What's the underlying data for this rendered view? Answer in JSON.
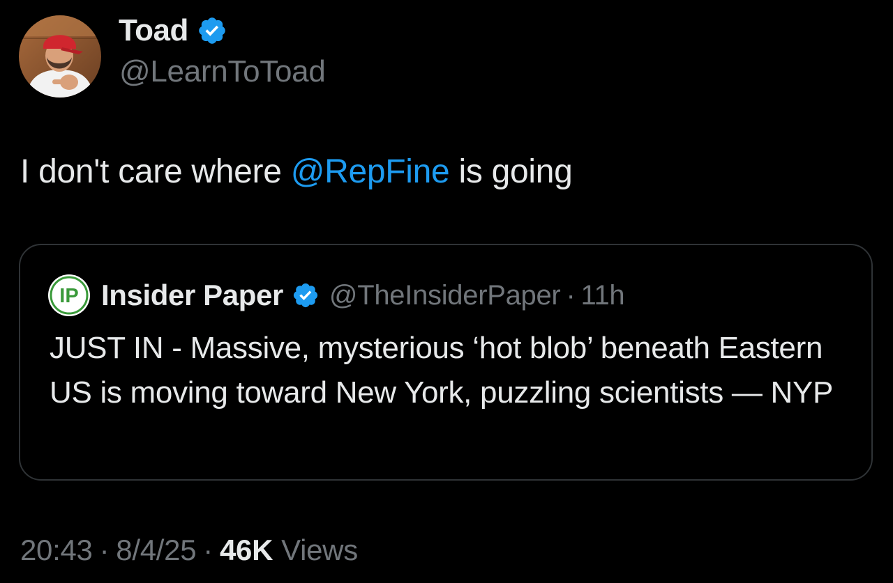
{
  "author": {
    "display_name": "Toad",
    "handle": "@LearnToToad",
    "verified_icon": "verified-badge-icon",
    "avatar": "profile-photo"
  },
  "tweet": {
    "text_before": "I don't care where ",
    "mention": "@RepFine",
    "text_after": " is going"
  },
  "quoted_tweet": {
    "avatar_letters": "IP",
    "display_name": "Insider Paper",
    "handle": "@TheInsiderPaper",
    "separator": "·",
    "time": "11h",
    "text": "JUST IN - Massive, mysterious ‘hot blob’ beneath Eastern US is moving toward New York, puzzling scientists — NYP"
  },
  "footer": {
    "time": "20:43",
    "separator": "·",
    "date": "8/4/25",
    "views_count": "46K",
    "views_label": "Views"
  },
  "colors": {
    "background": "#000000",
    "text_primary": "#e7e9ea",
    "text_secondary": "#71767b",
    "accent": "#1d9bf0",
    "border": "#2f3336",
    "quote_logo_green": "#3a9a3a"
  }
}
